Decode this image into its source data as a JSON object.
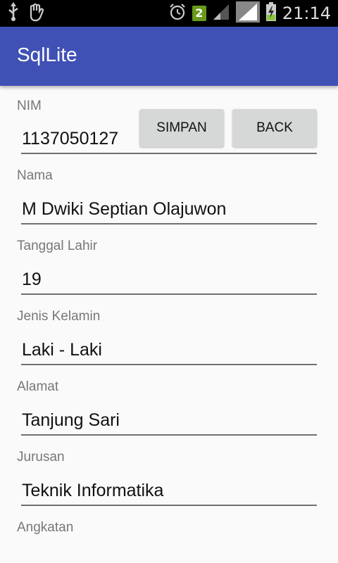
{
  "status_bar": {
    "time": "21:14",
    "notification_badge": "2",
    "icons": [
      "usb-icon",
      "hand-icon",
      "alarm-icon",
      "signal-icon",
      "signal-icon",
      "battery-charging-icon"
    ]
  },
  "app_bar": {
    "title": "SqlLite",
    "color": "#3f51b5"
  },
  "form": {
    "nim": {
      "label": "NIM",
      "value": "1137050127"
    },
    "nama": {
      "label": "Nama",
      "value": "M Dwiki Septian Olajuwon"
    },
    "tanggal_lahir": {
      "label": "Tanggal Lahir",
      "value": "19"
    },
    "jenis_kelamin": {
      "label": "Jenis Kelamin",
      "value": "Laki - Laki"
    },
    "alamat": {
      "label": "Alamat",
      "value": "Tanjung Sari"
    },
    "jurusan": {
      "label": "Jurusan",
      "value": "Teknik Informatika"
    },
    "angkatan": {
      "label": "Angkatan"
    }
  },
  "buttons": {
    "simpan": "SIMPAN",
    "back": "BACK"
  }
}
